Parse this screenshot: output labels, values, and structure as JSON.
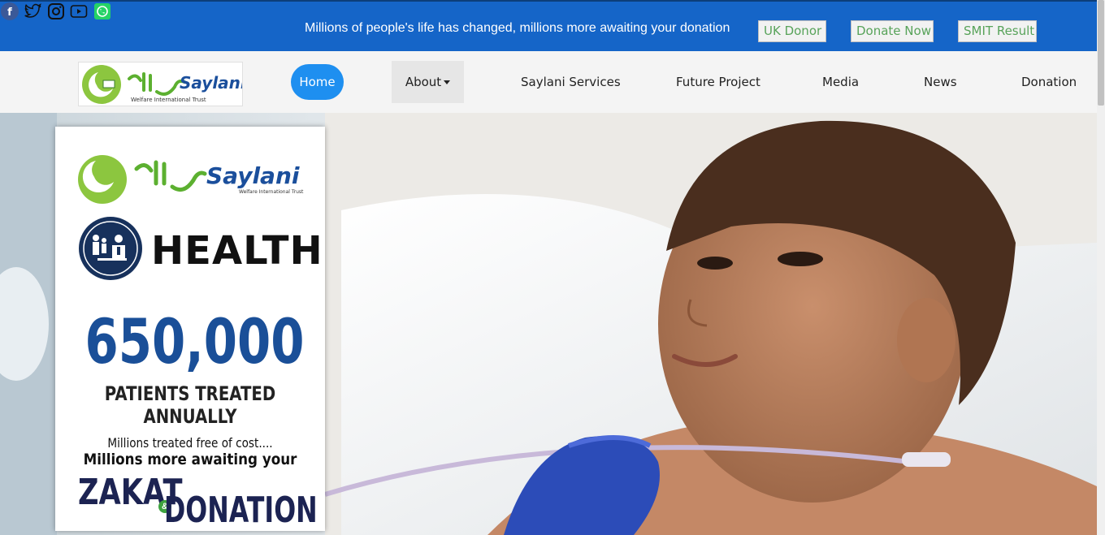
{
  "topbar": {
    "social_icons": [
      "facebook-icon",
      "twitter-icon",
      "instagram-icon",
      "youtube-icon",
      "whatsapp-icon"
    ],
    "message": "Millions of people's life has changed, millions more awaiting your donation",
    "buttons": {
      "uk_donor": "UK Donor",
      "donate_now": "Donate Now",
      "smit_result": "SMIT Result"
    }
  },
  "navbar": {
    "logo_text": "Saylani",
    "items": {
      "home": "Home",
      "about": "About",
      "services": "Saylani Services",
      "future": "Future Project",
      "media": "Media",
      "news": "News",
      "donation": "Donation"
    }
  },
  "hero": {
    "card": {
      "logo_text": "Saylani",
      "logo_subtext": "Welfare International Trust",
      "category": "HEALTH",
      "number": "650,000",
      "caption": "PATIENTS TREATED ANNUALLY",
      "line1": "Millions treated free of cost....",
      "line2": "Millions more awaiting your",
      "zakat": "ZAKAT",
      "amp": "&",
      "donation": "DONATION"
    }
  },
  "colors": {
    "topbar_bg": "#1565c8",
    "nav_active": "#1e8ff0",
    "button_text": "#58a35a",
    "card_number": "#1a4f98",
    "card_zakat": "#1c2352"
  }
}
